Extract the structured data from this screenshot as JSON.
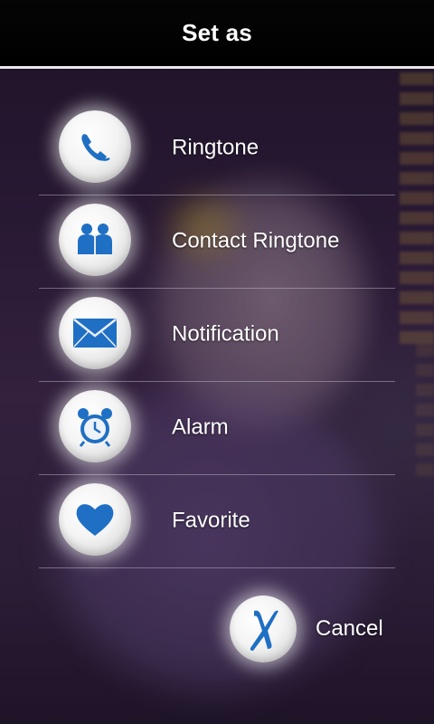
{
  "header": {
    "title": "Set as"
  },
  "options": [
    {
      "label": "Ringtone",
      "icon": "phone-handset-icon"
    },
    {
      "label": "Contact Ringtone",
      "icon": "contacts-people-icon"
    },
    {
      "label": "Notification",
      "icon": "envelope-icon"
    },
    {
      "label": "Alarm",
      "icon": "alarm-clock-icon"
    },
    {
      "label": "Favorite",
      "icon": "heart-icon"
    }
  ],
  "cancel": {
    "label": "Cancel",
    "icon": "close-x-icon"
  },
  "colors": {
    "icon_blue": "#1f6fc4",
    "header_bg": "#000000",
    "text": "#ffffff"
  }
}
